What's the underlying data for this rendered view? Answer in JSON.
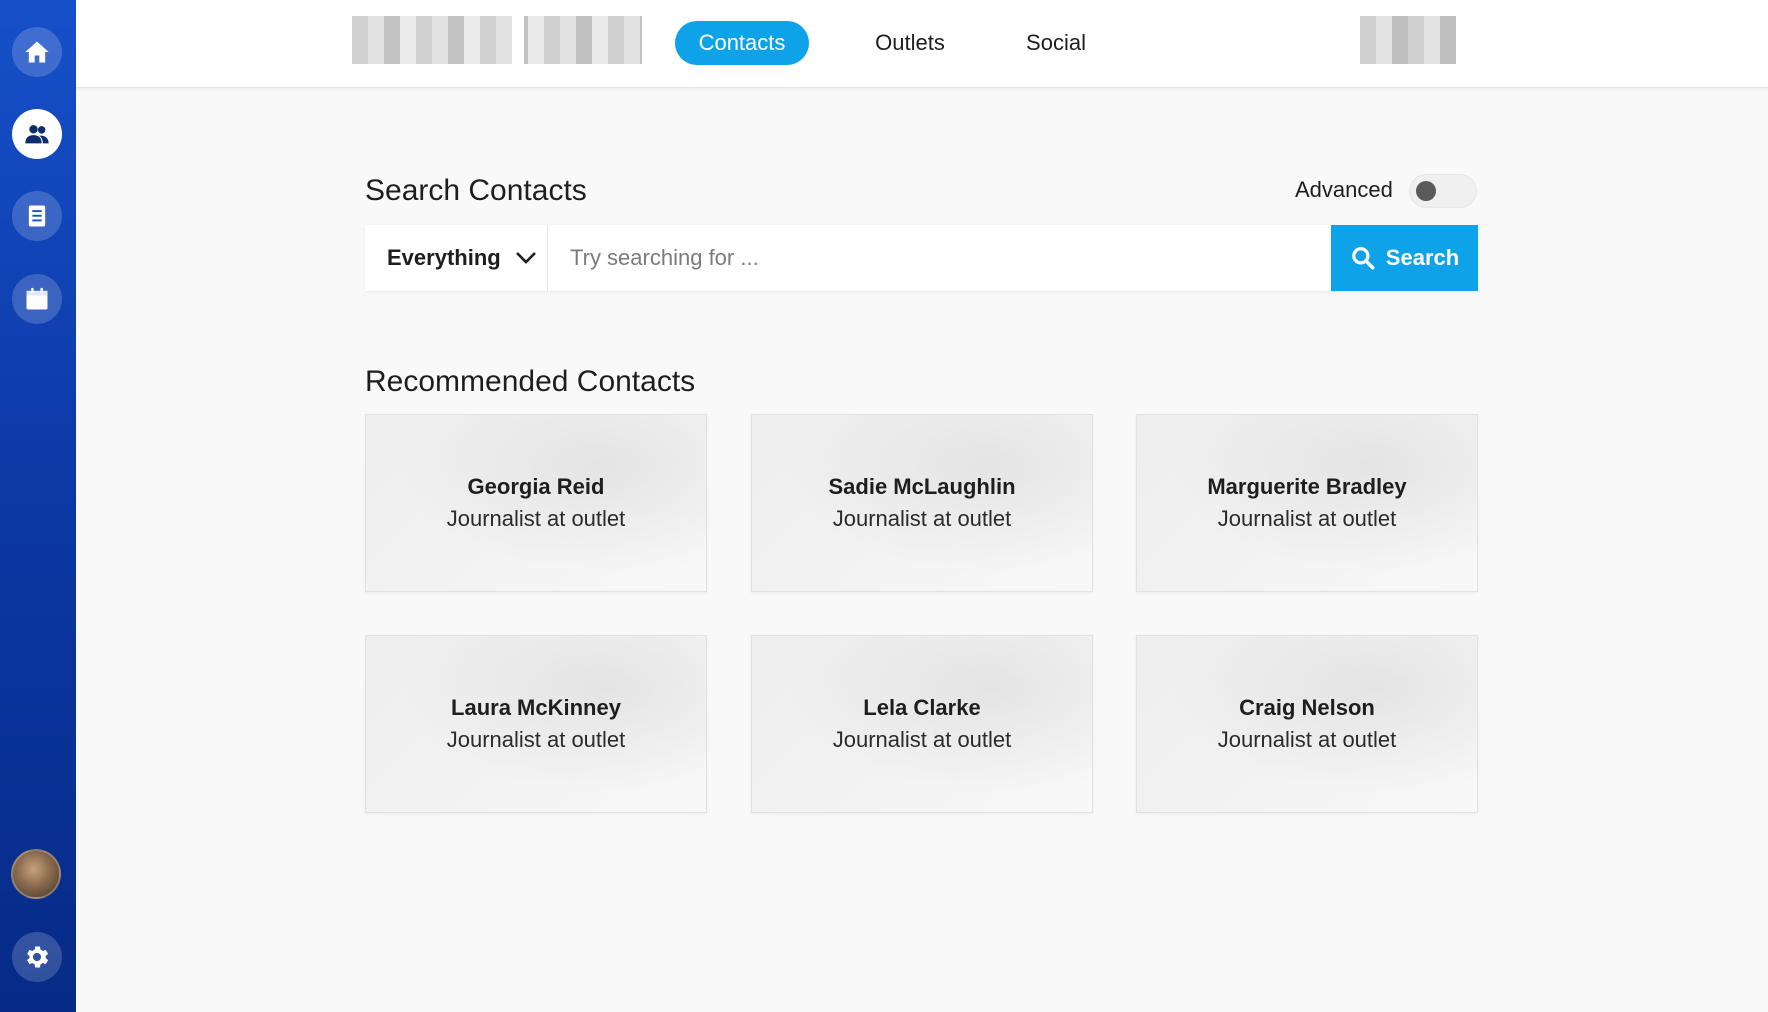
{
  "nav": {
    "tabs": [
      {
        "label": "Contacts",
        "active": true
      },
      {
        "label": "Outlets",
        "active": false
      },
      {
        "label": "Social",
        "active": false
      }
    ]
  },
  "sidebar": {
    "items": [
      {
        "icon": "home-icon"
      },
      {
        "icon": "contacts-icon",
        "active": true
      },
      {
        "icon": "document-icon"
      },
      {
        "icon": "calendar-icon"
      }
    ],
    "bottom": [
      {
        "icon": "avatar"
      },
      {
        "icon": "gear-icon"
      }
    ]
  },
  "search": {
    "title": "Search Contacts",
    "advanced_label": "Advanced",
    "advanced_enabled": false,
    "scope": "Everything",
    "placeholder": "Try searching for ...",
    "button_label": "Search"
  },
  "recommended": {
    "title": "Recommended Contacts",
    "contacts": [
      {
        "name": "Georgia Reid",
        "role": "Journalist at outlet"
      },
      {
        "name": "Sadie McLaughlin",
        "role": "Journalist at outlet"
      },
      {
        "name": "Marguerite Bradley",
        "role": "Journalist at outlet"
      },
      {
        "name": "Laura McKinney",
        "role": "Journalist at outlet"
      },
      {
        "name": "Lela Clarke",
        "role": "Journalist at outlet"
      },
      {
        "name": "Craig Nelson",
        "role": "Journalist at outlet"
      }
    ]
  },
  "colors": {
    "accent": "#0ea3e8",
    "sidebar_top": "#1650c9",
    "sidebar_bottom": "#062a86"
  }
}
